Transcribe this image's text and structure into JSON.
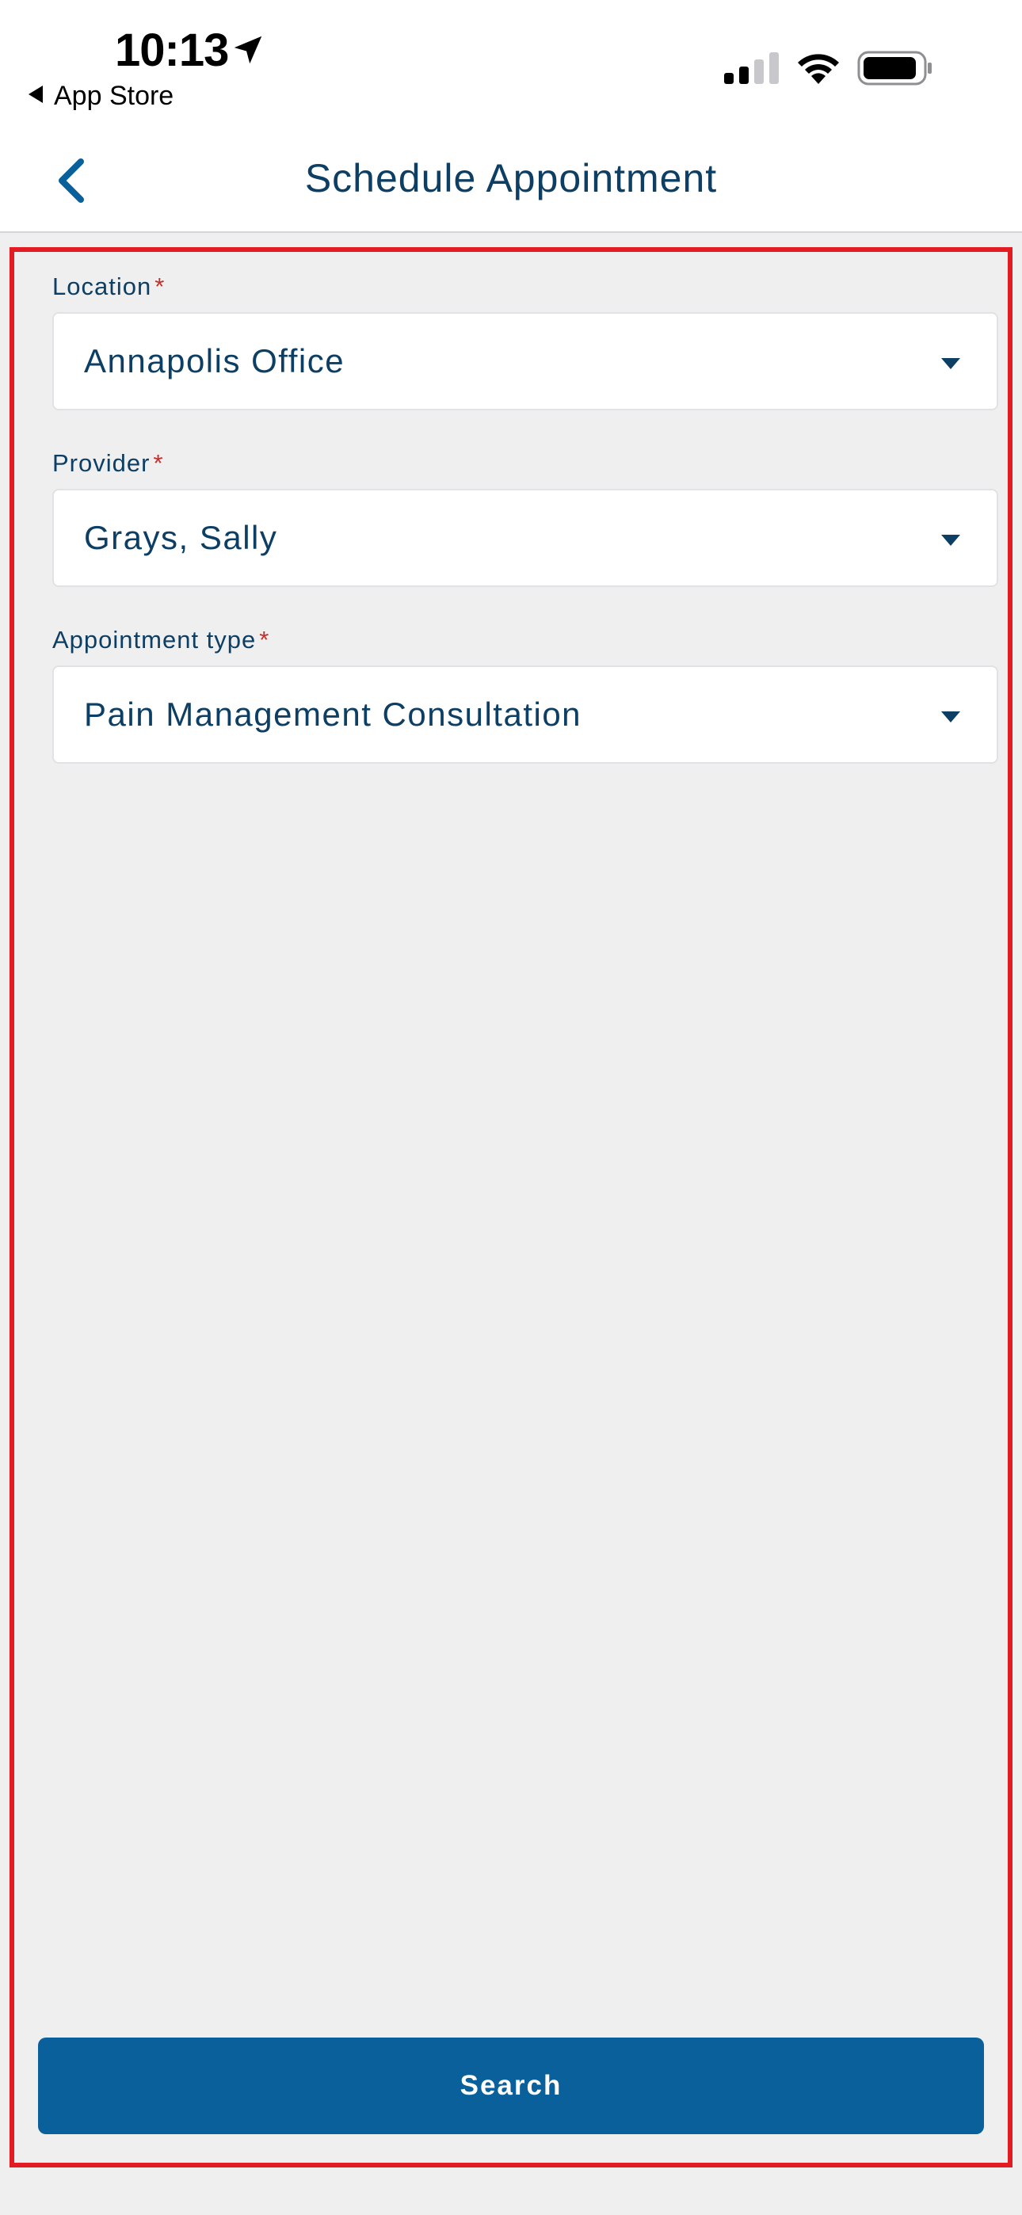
{
  "status_bar": {
    "time": "10:13",
    "back_to_app": "App Store"
  },
  "nav": {
    "title": "Schedule Appointment"
  },
  "form": {
    "location": {
      "label": "Location",
      "required_mark": "*",
      "value": "Annapolis Office"
    },
    "provider": {
      "label": "Provider",
      "required_mark": "*",
      "value": "Grays, Sally"
    },
    "appointment_type": {
      "label": "Appointment type",
      "required_mark": "*",
      "value": "Pain Management Consultation"
    }
  },
  "search_button": {
    "label": "Search"
  },
  "colors": {
    "brand_primary": "#0a609b",
    "text_primary": "#0d3e64",
    "required": "#c2302c",
    "highlight_frame": "#e31b23",
    "background": "#efeff0"
  },
  "icons": {
    "location": "location-arrow-icon",
    "signal": "cellular-signal-icon",
    "wifi": "wifi-icon",
    "battery": "battery-icon",
    "nav_back": "chevron-left-icon",
    "dropdown": "caret-down-icon"
  }
}
